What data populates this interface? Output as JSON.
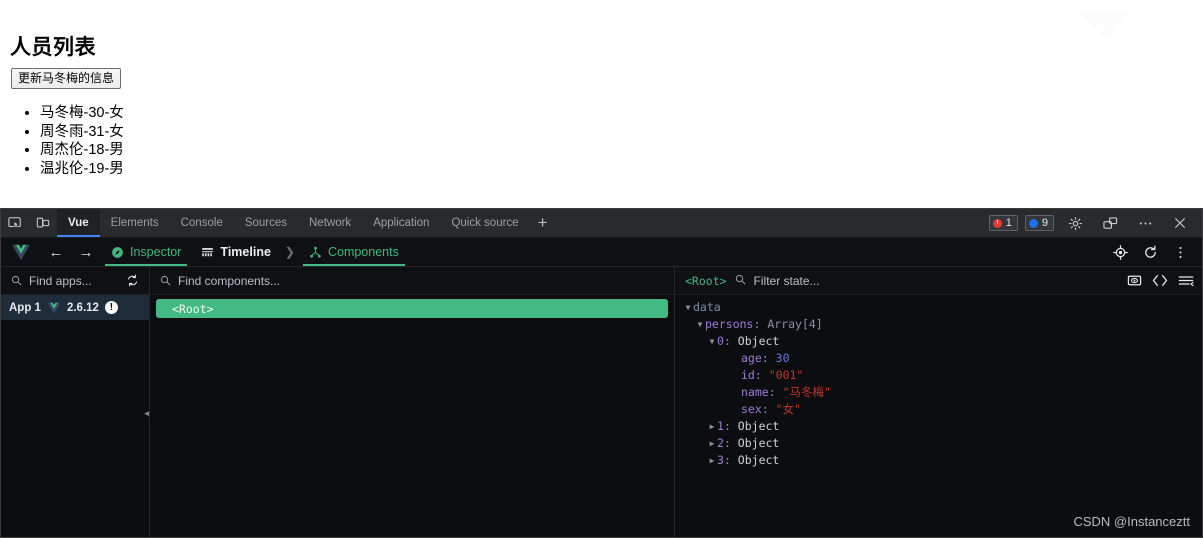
{
  "page": {
    "title": "人员列表",
    "update_button": "更新马冬梅的信息",
    "persons": [
      "马冬梅-30-女",
      "周冬雨-31-女",
      "周杰伦-18-男",
      "温兆伦-19-男"
    ]
  },
  "devtools": {
    "tabs": [
      {
        "label": "Vue",
        "active": true
      },
      {
        "label": "Elements",
        "active": false
      },
      {
        "label": "Console",
        "active": false
      },
      {
        "label": "Sources",
        "active": false
      },
      {
        "label": "Network",
        "active": false
      },
      {
        "label": "Application",
        "active": false
      },
      {
        "label": "Quick source",
        "active": false
      }
    ],
    "add_tab": "+",
    "badges": {
      "errors": "1",
      "infos": "9"
    },
    "toolbar_icons": {
      "inspect": "inspect-element-icon",
      "device": "device-toolbar-icon",
      "settings": "gear-icon",
      "dock": "dock-side-icon",
      "more": "more-options-icon",
      "close": "close-icon"
    }
  },
  "vue_toolbar": {
    "logo": "vue-logo",
    "back": "←",
    "forward": "→",
    "items": [
      {
        "label": "Inspector",
        "icon": "compass-icon",
        "style": "accent",
        "underlined": true
      },
      {
        "label": "Timeline",
        "icon": "timeline-icon",
        "style": "plain",
        "underlined": false
      }
    ],
    "separator": "❯",
    "current": {
      "label": "Components",
      "icon": "components-tree-icon"
    },
    "right_icons": {
      "select": "select-component-icon",
      "refresh": "refresh-icon",
      "menu": "kebab-menu-icon"
    }
  },
  "apps_panel": {
    "search_placeholder": "Find apps...",
    "sync_icon": "refresh-sync-icon",
    "items": [
      {
        "name": "App 1",
        "version": "2.6.12",
        "badge": "!"
      }
    ]
  },
  "components_panel": {
    "search_placeholder": "Find components...",
    "nodes": [
      {
        "label": "<Root>",
        "selected": true
      }
    ]
  },
  "state_panel": {
    "root_label": "<Root>",
    "filter_placeholder": "Filter state...",
    "icons": {
      "inspect_dom": "inspect-dom-icon",
      "open_editor": "open-in-editor-icon",
      "collapse": "collapse-all-icon"
    },
    "tree": [
      {
        "indent": 0,
        "arrow": "open",
        "key": "data",
        "keyClass": "k-group",
        "sep": "",
        "value": "",
        "valueClass": ""
      },
      {
        "indent": 1,
        "arrow": "open",
        "key": "persons",
        "keyClass": "k-key",
        "sep": ": ",
        "value": "Array[4]",
        "valueClass": "k-meta"
      },
      {
        "indent": 2,
        "arrow": "open",
        "key": "0",
        "keyClass": "k-key",
        "sep": ": ",
        "value": "Object",
        "valueClass": "k-obj"
      },
      {
        "indent": 4,
        "arrow": "none",
        "key": "age",
        "keyClass": "k-key",
        "sep": ": ",
        "value": "30",
        "valueClass": "k-num"
      },
      {
        "indent": 4,
        "arrow": "none",
        "key": "id",
        "keyClass": "k-key",
        "sep": ": ",
        "value": "\"001\"",
        "valueClass": "k-str"
      },
      {
        "indent": 4,
        "arrow": "none",
        "key": "name",
        "keyClass": "k-key",
        "sep": ": ",
        "value": "\"马冬梅\"",
        "valueClass": "k-str"
      },
      {
        "indent": 4,
        "arrow": "none",
        "key": "sex",
        "keyClass": "k-key",
        "sep": ": ",
        "value": "\"女\"",
        "valueClass": "k-str"
      },
      {
        "indent": 2,
        "arrow": "closed",
        "key": "1",
        "keyClass": "k-key",
        "sep": ": ",
        "value": "Object",
        "valueClass": "k-obj"
      },
      {
        "indent": 2,
        "arrow": "closed",
        "key": "2",
        "keyClass": "k-key",
        "sep": ": ",
        "value": "Object",
        "valueClass": "k-obj"
      },
      {
        "indent": 2,
        "arrow": "closed",
        "key": "3",
        "keyClass": "k-key",
        "sep": ": ",
        "value": "Object",
        "valueClass": "k-obj"
      }
    ]
  },
  "watermark": "CSDN @Instanceztt",
  "colors": {
    "vue_green": "#42b883",
    "devtools_bg": "#202124",
    "panel_bg": "#0b0d10",
    "tab_active_underline": "#4285f4",
    "error_red": "#e53935",
    "info_blue": "#1a73e8",
    "string_red": "#c0392b",
    "key_purple": "#9d7cd8",
    "number_blue": "#6c7ce0"
  }
}
